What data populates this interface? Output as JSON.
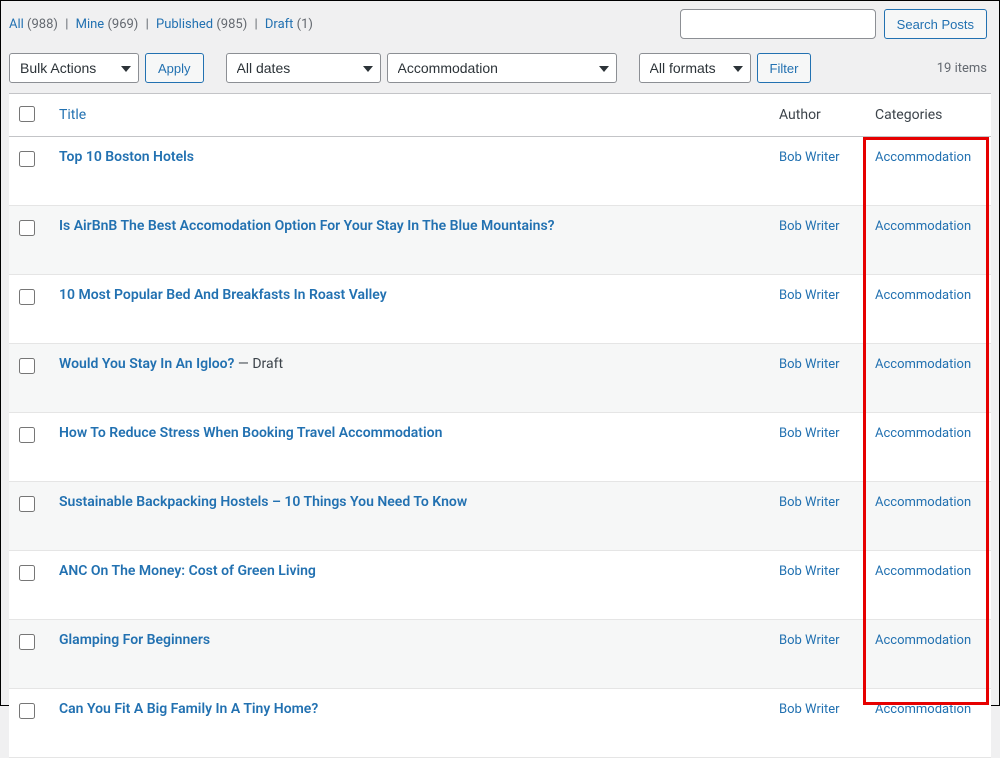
{
  "filter_links": {
    "all": {
      "label": "All",
      "count": "(988)"
    },
    "mine": {
      "label": "Mine",
      "count": "(969)"
    },
    "published": {
      "label": "Published",
      "count": "(985)"
    },
    "draft": {
      "label": "Draft",
      "count": "(1)"
    }
  },
  "search": {
    "value": "",
    "button": "Search Posts"
  },
  "tablenav": {
    "bulk_actions": "Bulk Actions",
    "apply": "Apply",
    "dates": "All dates",
    "category": "Accommodation",
    "formats": "All formats",
    "filter": "Filter",
    "items": "19 items"
  },
  "columns": {
    "title": "Title",
    "author": "Author",
    "categories": "Categories"
  },
  "rows": [
    {
      "title": "Top 10 Boston Hotels",
      "suffix": "",
      "author": "Bob Writer",
      "category": "Accommodation"
    },
    {
      "title": "Is AirBnB The Best Accomodation Option For Your Stay In The Blue Mountains?",
      "suffix": "",
      "author": "Bob Writer",
      "category": "Accommodation"
    },
    {
      "title": "10 Most Popular Bed And Breakfasts In Roast Valley",
      "suffix": "",
      "author": "Bob Writer",
      "category": "Accommodation"
    },
    {
      "title": "Would You Stay In An Igloo?",
      "suffix": " — Draft",
      "author": "Bob Writer",
      "category": "Accommodation"
    },
    {
      "title": "How To Reduce Stress When Booking Travel Accommodation",
      "suffix": "",
      "author": "Bob Writer",
      "category": "Accommodation"
    },
    {
      "title": "Sustainable Backpacking Hostels – 10 Things You Need To Know",
      "suffix": "",
      "author": "Bob Writer",
      "category": "Accommodation"
    },
    {
      "title": "ANC On The Money: Cost of Green Living",
      "suffix": "",
      "author": "Bob Writer",
      "category": "Accommodation"
    },
    {
      "title": "Glamping For Beginners",
      "suffix": "",
      "author": "Bob Writer",
      "category": "Accommodation"
    },
    {
      "title": "Can You Fit A Big Family In A Tiny Home?",
      "suffix": "",
      "author": "Bob Writer",
      "category": "Accommodation"
    }
  ]
}
